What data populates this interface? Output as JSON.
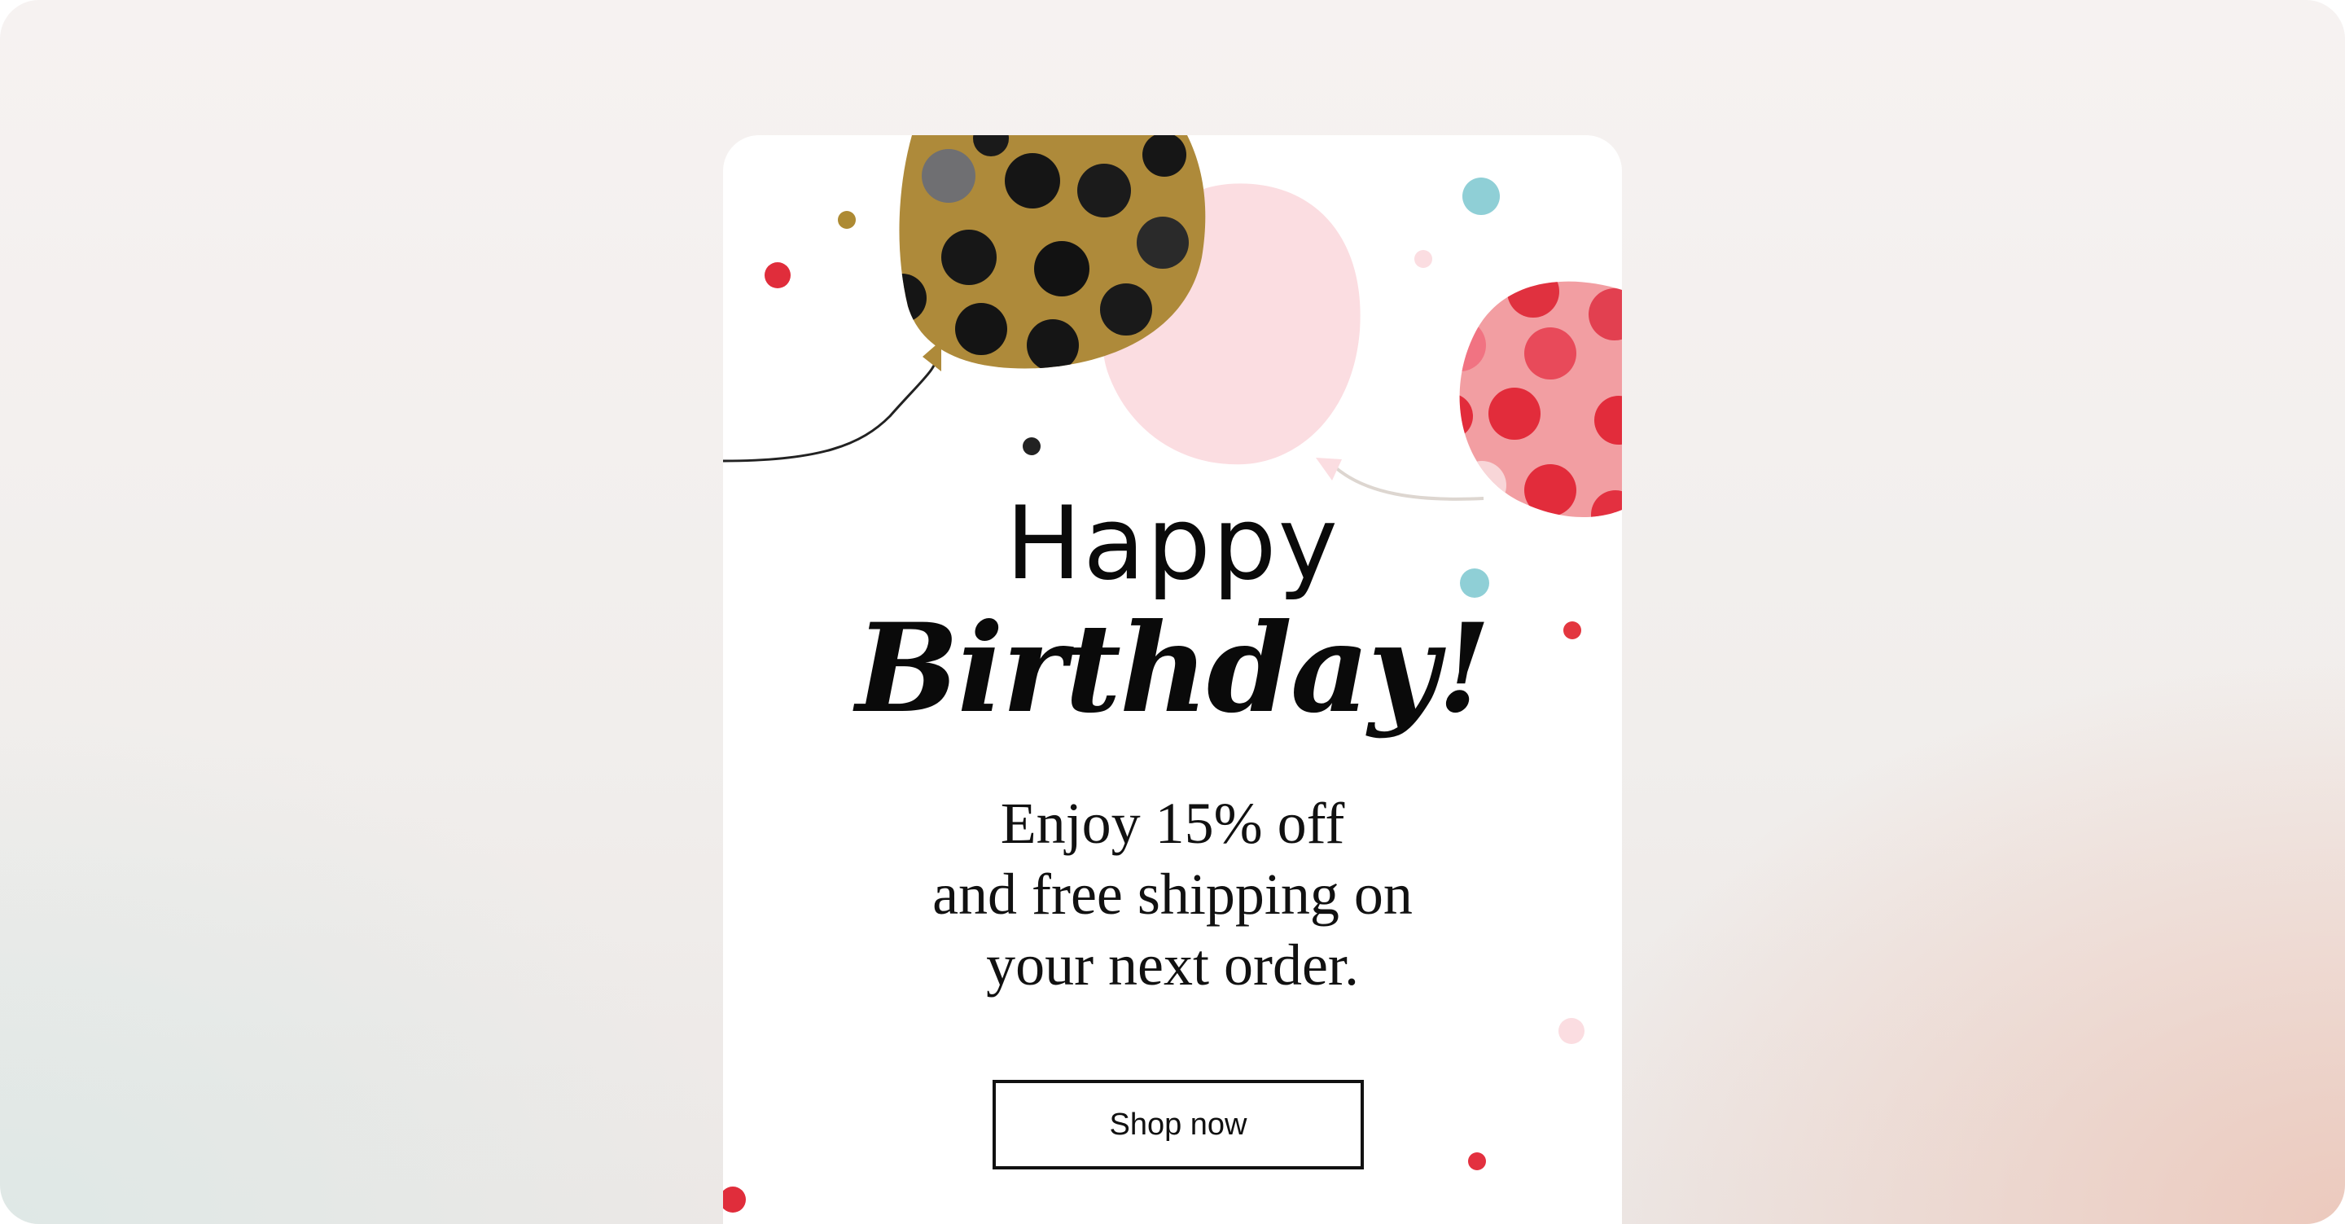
{
  "card": {
    "title_line1": "Happy",
    "title_line2": "Birthday!",
    "offer_line1": "Enjoy 15% off",
    "offer_line2": "and free shipping on",
    "offer_line3": "your next order.",
    "cta_label": "Shop now"
  },
  "colors": {
    "gold_balloon": "#ae8a3a",
    "pink_balloon": "#fbdde1",
    "coral_balloon": "#f29ea2",
    "red_dot": "#e3303f",
    "teal_dot": "#8fcfd6",
    "text": "#0a0a0a"
  },
  "icons": [
    "gold-polka-balloon",
    "pink-balloon",
    "coral-polka-balloon",
    "confetti-dots"
  ]
}
